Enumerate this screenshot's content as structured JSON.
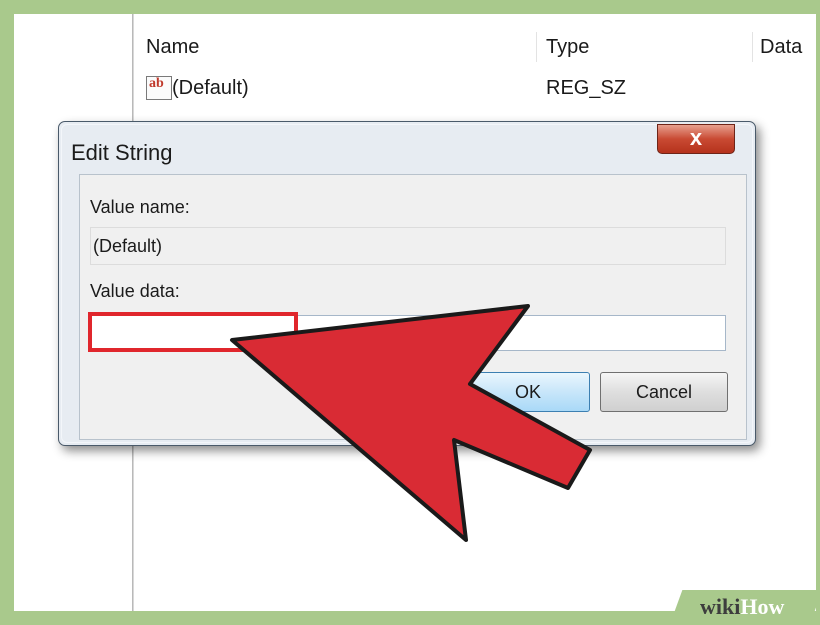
{
  "list_header": {
    "name": "Name",
    "type": "Type",
    "data": "Data"
  },
  "row": {
    "icon": "string-value-icon",
    "icon_glyph": "ab",
    "name": "(Default)",
    "type": "REG_SZ"
  },
  "dialog": {
    "title": "Edit String",
    "close_glyph": "x",
    "value_name_label": "Value name:",
    "value_name": "(Default)",
    "value_data_label": "Value data:",
    "value_data": "",
    "ok_label": "OK",
    "cancel_label": "Cancel"
  },
  "annotation": {
    "highlight_color": "#e0262c",
    "arrow_color": "#d92b34"
  },
  "watermark": {
    "wiki": "wiki",
    "how": "How"
  }
}
